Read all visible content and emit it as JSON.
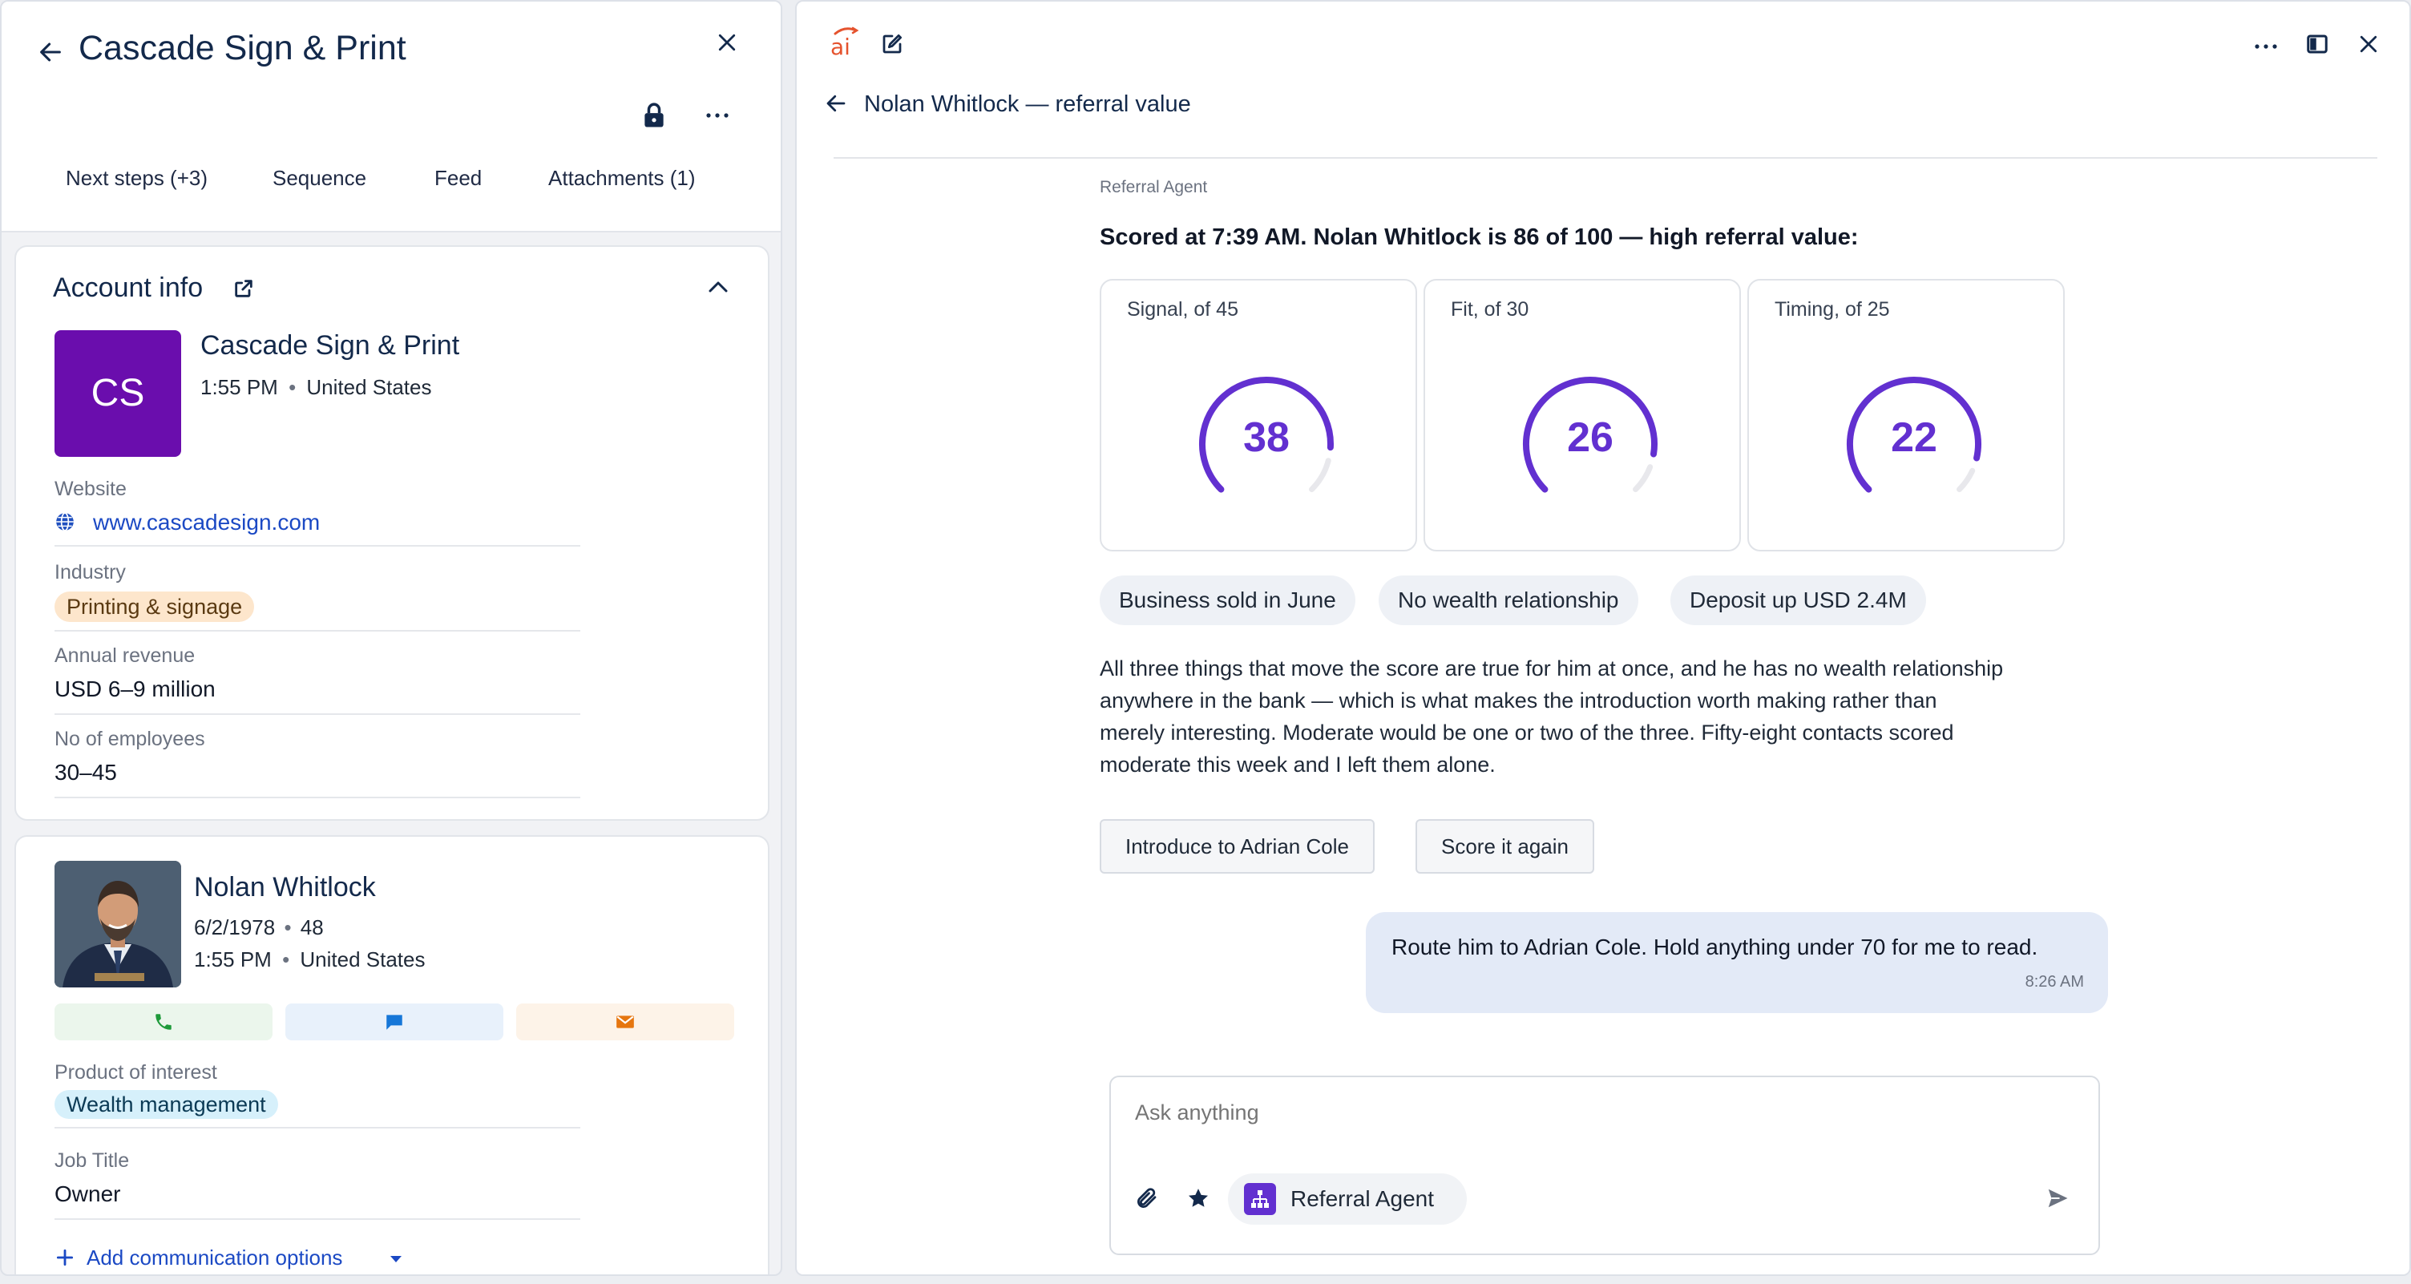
{
  "left_panel": {
    "title": "Cascade Sign & Print",
    "tabs": [
      "Next steps (+3)",
      "Sequence",
      "Feed",
      "Attachments (1)"
    ],
    "account_info": {
      "heading": "Account info",
      "initials": "CS",
      "avatar_color": "#6a0dad",
      "name": "Cascade Sign & Print",
      "time": "1:55 PM",
      "location": "United States",
      "website_label": "Website",
      "website": "www.cascadesign.com",
      "industry_label": "Industry",
      "industry": "Printing & signage",
      "revenue_label": "Annual revenue",
      "revenue": "USD 6–9 million",
      "employees_label": "No of employees",
      "employees": "30–45"
    },
    "contact": {
      "name": "Nolan Whitlock",
      "dob": "6/2/1978",
      "age": "48",
      "time": "1:55 PM",
      "location": "United States",
      "product_label": "Product of interest",
      "product": "Wealth management",
      "job_label": "Job Title",
      "job": "Owner",
      "add_comm": "Add communication options"
    }
  },
  "right_panel": {
    "conversation_title": "Nolan Whitlock — referral value",
    "agent_label": "Referral Agent",
    "headline": "Scored at 7:39 AM. Nolan Whitlock is 86 of 100 — high referral value:",
    "scores": [
      {
        "label": "Signal, of 45",
        "value": "38",
        "max": 45
      },
      {
        "label": "Fit, of 30",
        "value": "26",
        "max": 30
      },
      {
        "label": "Timing, of 25",
        "value": "22",
        "max": 25
      }
    ],
    "factors": [
      "Business sold in June",
      "No wealth relationship",
      "Deposit up USD 2.4M"
    ],
    "explanation": [
      "All three things that move the score are true for him at once, and he has no wealth relationship",
      "anywhere in the bank — which is what makes the introduction worth making rather than",
      "merely interesting. Moderate would be one or two of the three. Fifty-eight contacts scored",
      "moderate this week and I left them alone."
    ],
    "actions": [
      "Introduce to Adrian Cole",
      "Score it again"
    ],
    "user_message": "Route him to Adrian Cole. Hold anything under 70 for me to read.",
    "user_message_time": "8:26 AM",
    "input_placeholder": "Ask anything",
    "agent_chip": "Referral Agent",
    "accent": "#6230d0"
  }
}
